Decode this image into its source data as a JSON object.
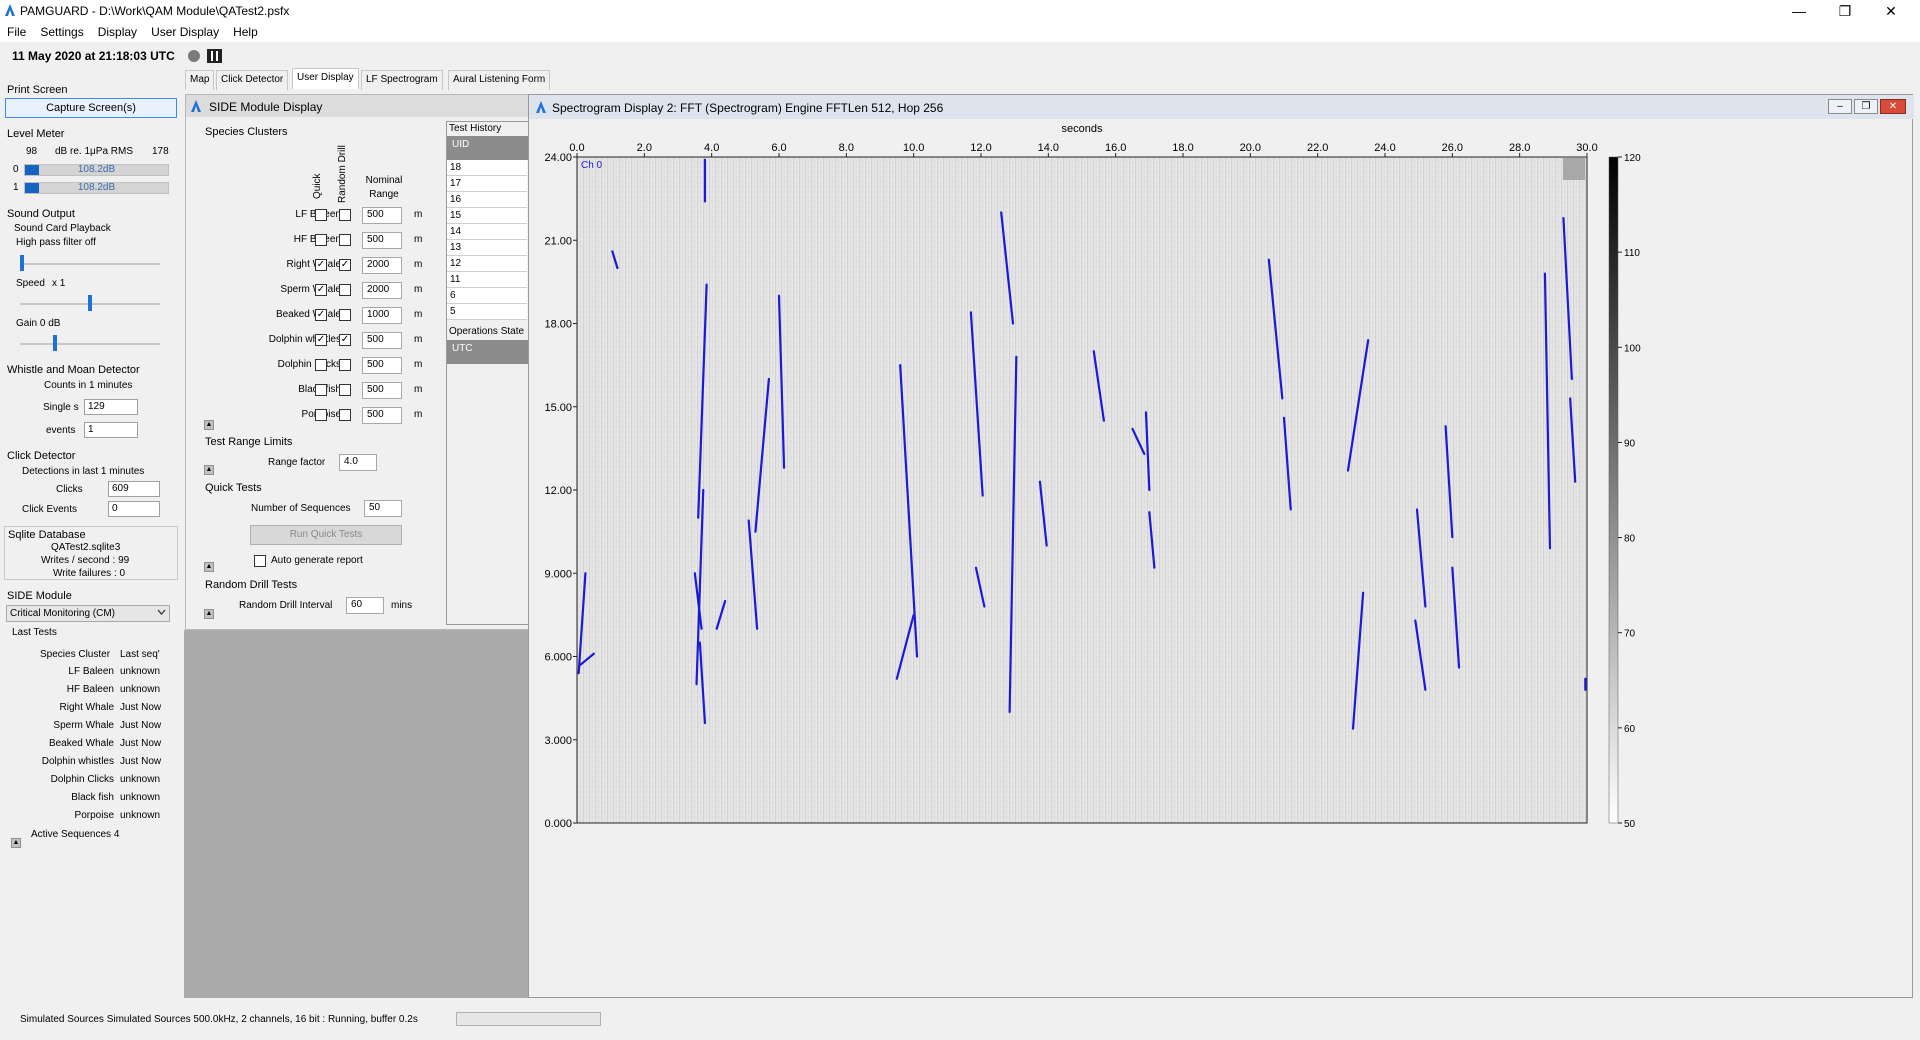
{
  "window": {
    "title": "PAMGUARD - D:\\Work\\QAM Module\\QATest2.psfx",
    "min": "—",
    "max": "❐",
    "close": "✕"
  },
  "menu": [
    "File",
    "Settings",
    "Display",
    "User Display",
    "Help"
  ],
  "timebar": {
    "time": "11 May 2020 at 21:18:03 UTC"
  },
  "left": {
    "print_screen": "Print Screen",
    "capture_button": "Capture Screen(s)",
    "level_meter": "Level Meter",
    "level_min": "98",
    "level_unit": "dB re. 1μPa RMS",
    "level_max": "178",
    "channels": [
      {
        "ch": "0",
        "value": "108.2dB",
        "fraction": 0.1
      },
      {
        "ch": "1",
        "value": "108.2dB",
        "fraction": 0.1
      }
    ],
    "sound_output": "Sound Output",
    "sound_card": "Sound Card Playback",
    "high_pass": "High pass filter off",
    "speed_label": "Speed",
    "speed_value": "x 1",
    "gain_label": "Gain 0 dB",
    "whistle_title": "Whistle and Moan Detector",
    "counts_in": "Counts in 1 minutes",
    "single_s_label": "Single s",
    "single_s_value": "129",
    "events_label": "events",
    "events_value": "1",
    "click_title": "Click Detector",
    "detections_last": "Detections in last 1 minutes",
    "clicks_label": "Clicks",
    "clicks_value": "609",
    "click_events_label": "Click Events",
    "click_events_value": "0",
    "sqlite_title": "Sqlite Database",
    "sqlite_file": "QATest2.sqlite3",
    "writes_per_second": "Writes / second : 99",
    "write_failures": "Write failures : 0",
    "side_module": "SIDE Module",
    "side_select": "Critical Monitoring (CM)",
    "last_tests": "Last Tests",
    "lt_header": [
      "Species Cluster",
      "Last seq'"
    ],
    "lt_rows": [
      [
        "LF Baleen",
        "unknown"
      ],
      [
        "HF Baleen",
        "unknown"
      ],
      [
        "Right Whale",
        "Just Now"
      ],
      [
        "Sperm Whale",
        "Just Now"
      ],
      [
        "Beaked Whale",
        "Just Now"
      ],
      [
        "Dolphin whistles",
        "Just Now"
      ],
      [
        "Dolphin Clicks",
        "unknown"
      ],
      [
        "Black fish",
        "unknown"
      ],
      [
        "Porpoise",
        "unknown"
      ]
    ],
    "active_sequences": "Active Sequences 4"
  },
  "tabs": [
    "Map",
    "Click Detector",
    "User Display",
    "LF Spectrogram",
    "Aural Listening Form"
  ],
  "side": {
    "title": "SIDE Module Display",
    "species_clusters": "Species Clusters",
    "col_quick": "Quick",
    "col_random": "Random Drill",
    "col_nominal": "Nominal",
    "col_range": "Range",
    "unit": "m",
    "rows": [
      {
        "name": "LF Baleen",
        "quick": false,
        "random": false,
        "range": "500"
      },
      {
        "name": "HF Baleen",
        "quick": false,
        "random": false,
        "range": "500"
      },
      {
        "name": "Right Whale",
        "quick": true,
        "random": true,
        "range": "2000"
      },
      {
        "name": "Sperm Whale",
        "quick": true,
        "random": false,
        "range": "2000"
      },
      {
        "name": "Beaked Whale",
        "quick": true,
        "random": false,
        "range": "1000"
      },
      {
        "name": "Dolphin whistles",
        "quick": true,
        "random": true,
        "range": "500"
      },
      {
        "name": "Dolphin Clicks",
        "quick": false,
        "random": false,
        "range": "500"
      },
      {
        "name": "Black fish",
        "quick": false,
        "random": false,
        "range": "500"
      },
      {
        "name": "Porpoise",
        "quick": false,
        "random": false,
        "range": "500"
      }
    ],
    "test_range_limits": "Test Range Limits",
    "range_factor_label": "Range factor",
    "range_factor_value": "4.0",
    "quick_tests": "Quick Tests",
    "num_sequences_label": "Number of Sequences",
    "num_sequences_value": "50",
    "run_quick_tests": "Run Quick Tests",
    "auto_generate": "Auto generate report",
    "random_drill_tests": "Random Drill Tests",
    "random_drill_interval_label": "Random Drill Interval",
    "random_drill_interval_value": "60",
    "random_drill_unit": "mins",
    "test_history": "Test History",
    "history_header": "UID",
    "history_rows": [
      "18",
      "17",
      "16",
      "15",
      "14",
      "13",
      "12",
      "11",
      "6",
      "5"
    ],
    "operations_state": "Operations State",
    "ops_header": "UTC"
  },
  "spectrogram": {
    "title": "Spectrogram Display 2: FFT (Spectrogram) Engine FFTLen 512, Hop 256",
    "xlabel": "seconds",
    "channel": "Ch 0",
    "x_ticks": [
      "0.0",
      "2.0",
      "4.0",
      "6.0",
      "8.0",
      "10.0",
      "12.0",
      "14.0",
      "16.0",
      "18.0",
      "20.0",
      "22.0",
      "24.0",
      "26.0",
      "28.0",
      "30.0"
    ],
    "y_ticks": [
      "0.000",
      "3.000",
      "6.000",
      "9.000",
      "12.00",
      "15.00",
      "18.00",
      "21.00",
      "24.00"
    ],
    "colorbar_ticks": [
      "50",
      "60",
      "70",
      "80",
      "90",
      "100",
      "110",
      "120"
    ],
    "xlim": [
      0,
      30
    ],
    "ylim": [
      0,
      24
    ],
    "trace_color": "#1a1ad8",
    "traces": [
      [
        [
          0.05,
          5.4
        ],
        [
          0.25,
          9.0
        ]
      ],
      [
        [
          0.1,
          5.7
        ],
        [
          0.5,
          6.1
        ]
      ],
      [
        [
          1.05,
          20.6
        ],
        [
          1.2,
          20.0
        ]
      ],
      [
        [
          3.55,
          5.0
        ],
        [
          3.75,
          12.0
        ]
      ],
      [
        [
          3.6,
          11.0
        ],
        [
          3.85,
          19.4
        ]
      ],
      [
        [
          3.8,
          23.9
        ],
        [
          3.8,
          22.4
        ]
      ],
      [
        [
          3.5,
          9.0
        ],
        [
          3.7,
          7.0
        ]
      ],
      [
        [
          3.65,
          6.5
        ],
        [
          3.8,
          3.6
        ]
      ],
      [
        [
          4.15,
          7.0
        ],
        [
          4.4,
          8.0
        ]
      ],
      [
        [
          5.1,
          10.9
        ],
        [
          5.35,
          7.0
        ]
      ],
      [
        [
          5.3,
          10.5
        ],
        [
          5.7,
          16.0
        ]
      ],
      [
        [
          6.0,
          19.0
        ],
        [
          6.15,
          12.8
        ]
      ],
      [
        [
          9.6,
          16.5
        ],
        [
          10.1,
          6.0
        ]
      ],
      [
        [
          9.5,
          5.2
        ],
        [
          10.0,
          7.5
        ]
      ],
      [
        [
          11.7,
          18.4
        ],
        [
          12.05,
          11.8
        ]
      ],
      [
        [
          11.85,
          9.2
        ],
        [
          12.1,
          7.8
        ]
      ],
      [
        [
          12.6,
          22.0
        ],
        [
          12.95,
          18.0
        ]
      ],
      [
        [
          12.85,
          4.0
        ],
        [
          13.05,
          16.8
        ]
      ],
      [
        [
          13.75,
          12.3
        ],
        [
          13.95,
          10.0
        ]
      ],
      [
        [
          15.35,
          17.0
        ],
        [
          15.65,
          14.5
        ]
      ],
      [
        [
          16.5,
          14.2
        ],
        [
          16.85,
          13.3
        ]
      ],
      [
        [
          16.9,
          14.8
        ],
        [
          17.0,
          12.0
        ]
      ],
      [
        [
          17.0,
          11.2
        ],
        [
          17.15,
          9.2
        ]
      ],
      [
        [
          20.55,
          20.3
        ],
        [
          20.95,
          15.3
        ]
      ],
      [
        [
          21.0,
          14.6
        ],
        [
          21.2,
          11.3
        ]
      ],
      [
        [
          22.9,
          12.7
        ],
        [
          23.5,
          17.4
        ]
      ],
      [
        [
          23.05,
          3.4
        ],
        [
          23.35,
          8.3
        ]
      ],
      [
        [
          24.95,
          11.3
        ],
        [
          25.2,
          7.8
        ]
      ],
      [
        [
          24.9,
          7.3
        ],
        [
          25.2,
          4.8
        ]
      ],
      [
        [
          25.8,
          14.3
        ],
        [
          26.0,
          10.3
        ]
      ],
      [
        [
          26.0,
          9.2
        ],
        [
          26.2,
          5.6
        ]
      ],
      [
        [
          28.75,
          19.8
        ],
        [
          28.9,
          9.9
        ]
      ],
      [
        [
          29.3,
          21.8
        ],
        [
          29.55,
          16.0
        ]
      ],
      [
        [
          29.5,
          15.3
        ],
        [
          29.65,
          12.3
        ]
      ],
      [
        [
          29.95,
          5.2
        ],
        [
          29.95,
          4.8
        ]
      ]
    ]
  },
  "status": {
    "text": "Simulated Sources Simulated Sources 500.0kHz, 2 channels, 16 bit : Running, buffer 0.2s"
  }
}
